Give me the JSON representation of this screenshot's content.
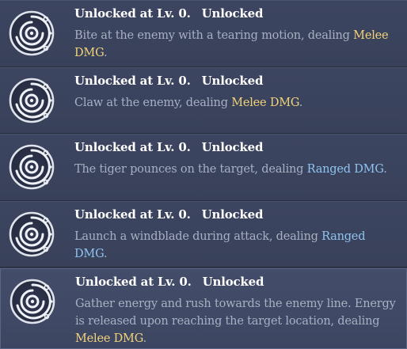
{
  "skills": [
    {
      "unlock_level": "Unlocked at Lv. 0.",
      "status": "Unlocked",
      "desc_before": "Bite at the enemy with a tearing motion, dealing ",
      "keyword": "Melee DMG",
      "keyword_type": "melee",
      "desc_after": ".",
      "icon": "skill-swirl-icon"
    },
    {
      "unlock_level": "Unlocked at Lv. 0.",
      "status": "Unlocked",
      "desc_before": "Claw at the enemy, dealing ",
      "keyword": "Melee DMG",
      "keyword_type": "melee",
      "desc_after": ".",
      "icon": "skill-swirl-icon"
    },
    {
      "unlock_level": "Unlocked at Lv. 0.",
      "status": "Unlocked",
      "desc_before": "The tiger pounces on the target, dealing ",
      "keyword": "Ranged DMG",
      "keyword_type": "ranged",
      "desc_after": ".",
      "icon": "skill-swirl-icon"
    },
    {
      "unlock_level": "Unlocked at Lv. 0.",
      "status": "Unlocked",
      "desc_before": "Launch a windblade during attack, dealing ",
      "keyword": "Ranged DMG",
      "keyword_type": "ranged",
      "desc_after": ".",
      "icon": "skill-swirl-icon"
    },
    {
      "unlock_level": "Unlocked at Lv. 0.",
      "status": "Unlocked",
      "desc_before": "Gather energy and rush towards the enemy line. Energy is released upon reaching the target location, dealing ",
      "keyword": "Melee DMG",
      "keyword_type": "melee",
      "desc_after": ".",
      "icon": "skill-swirl-icon"
    }
  ],
  "colors": {
    "melee": "#f2d27a",
    "ranged": "#8fc3f0",
    "title": "#ffffff",
    "description": "#a9b0c2"
  }
}
